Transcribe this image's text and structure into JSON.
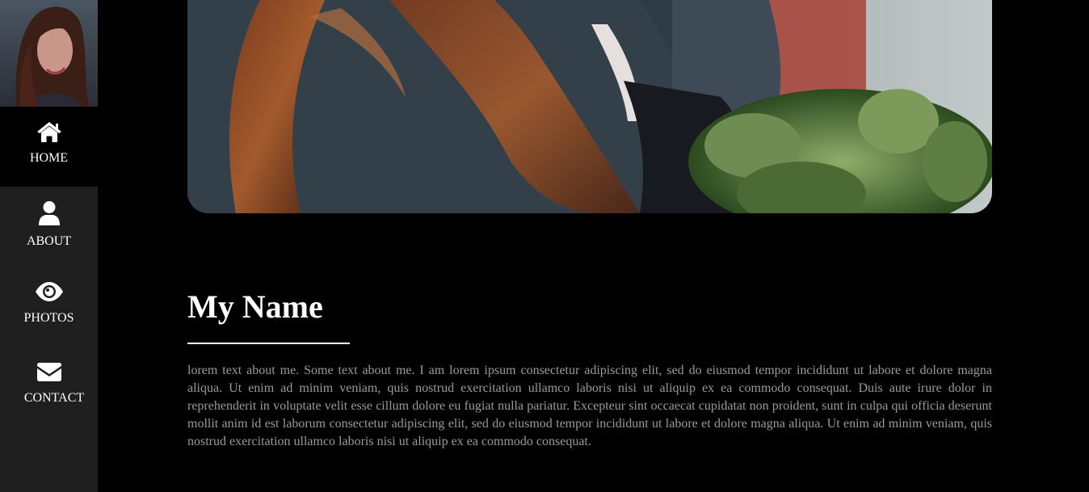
{
  "sidebar": {
    "avatar_alt": "profile photo",
    "nav": [
      {
        "label": "HOME",
        "icon": "home-icon",
        "active": true
      },
      {
        "label": "ABOUT",
        "icon": "user-icon",
        "active": false
      },
      {
        "label": "PHOTOS",
        "icon": "eye-icon",
        "active": false
      },
      {
        "label": "CONTACT",
        "icon": "envelope-icon",
        "active": false
      }
    ]
  },
  "main": {
    "title": "My Name",
    "bio": "lorem text about me. Some text about me. I am lorem ipsum consectetur adipiscing elit, sed do eiusmod tempor incididunt ut labore et dolore magna aliqua. Ut enim ad minim veniam, quis nostrud exercitation ullamco laboris nisi ut aliquip ex ea commodo consequat. Duis aute irure dolor in reprehenderit in voluptate velit esse cillum dolore eu fugiat nulla pariatur. Excepteur sint occaecat cupidatat non proident, sunt in culpa qui officia deserunt mollit anim id est laborum consectetur adipiscing elit, sed do eiusmod tempor incididunt ut labore et dolore magna aliqua. Ut enim ad minim veniam, quis nostrud exercitation ullamco laboris nisi ut aliquip ex ea commodo consequat."
  },
  "colors": {
    "background": "#000000",
    "sidebar": "#1f1f1f",
    "active_nav": "#000000",
    "text": "#ffffff",
    "body_text": "#9a9a9a"
  }
}
